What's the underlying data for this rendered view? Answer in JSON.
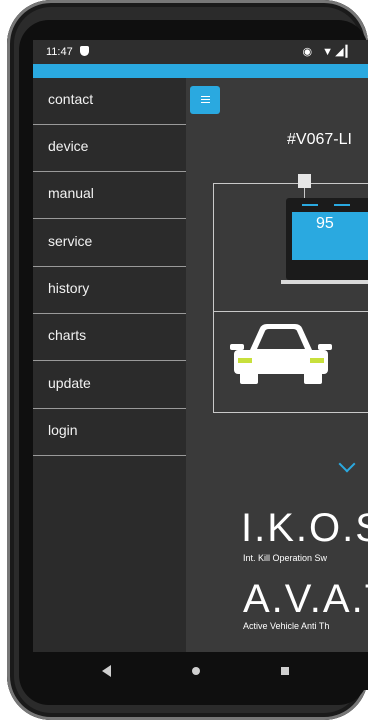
{
  "status_bar": {
    "time": "11:47",
    "icons": "◉ ▼◢▎"
  },
  "drawer": {
    "items": [
      {
        "label": "contact"
      },
      {
        "label": "device"
      },
      {
        "label": "manual"
      },
      {
        "label": "service"
      },
      {
        "label": "history"
      },
      {
        "label": "charts"
      },
      {
        "label": "update"
      },
      {
        "label": "login"
      }
    ]
  },
  "main": {
    "vehicle_id": "#V067-LI",
    "battery_value": "95",
    "ikos": {
      "title": "I.K.O.S",
      "subtitle": "Int. Kill Operation Sw"
    },
    "avat": {
      "title": "A.V.A.T",
      "subtitle": "Active Vehicle Anti Th"
    }
  },
  "colors": {
    "accent": "#2aa9e0",
    "drawer_bg": "#2b2b2b",
    "content_bg": "#3a3a3a",
    "headlight": "#c8e03c"
  }
}
